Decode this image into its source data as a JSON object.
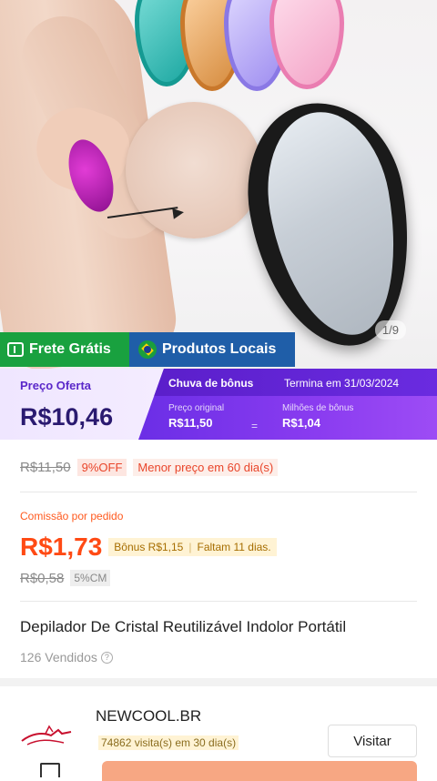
{
  "product_image": {
    "page_indicator": "1/9"
  },
  "badges": {
    "free_shipping": "Frete Grátis",
    "local_products": "Produtos Locais"
  },
  "price_banner": {
    "offer_label": "Preço Oferta",
    "offer_price": "R$10,46",
    "bonus_title": "Chuva de bônus",
    "bonus_ends": "Termina em 31/03/2024",
    "original_price_label": "Preço original",
    "original_price": "R$11,50",
    "minus": "=",
    "bonus_label": "Milhões de bônus",
    "bonus_value": "R$1,04"
  },
  "price_details": {
    "old_price": "R$11,50",
    "discount": "9%OFF",
    "lowest_price": "Menor preço em 60 dia(s)"
  },
  "commission": {
    "label": "Comissão por pedido",
    "value": "R$1,73",
    "bonus": "Bônus R$1,15",
    "remaining": "Faltam 11 dias.",
    "old_value": "R$0,58",
    "rate": "5%CM"
  },
  "product": {
    "title": "Depilador De Cristal Reutilizável Indolor Portátil",
    "sold": "126 Vendidos"
  },
  "store": {
    "name": "NEWCOOL.BR",
    "visits": "74862 visita(s) em 30 dia(s)",
    "visit_button": "Visitar"
  },
  "colors": {
    "accent_orange": "#ff4a14",
    "bonus_purple": "#6b2ee6",
    "free_shipping_green": "#19a13f",
    "local_blue": "#1f5ea8"
  }
}
